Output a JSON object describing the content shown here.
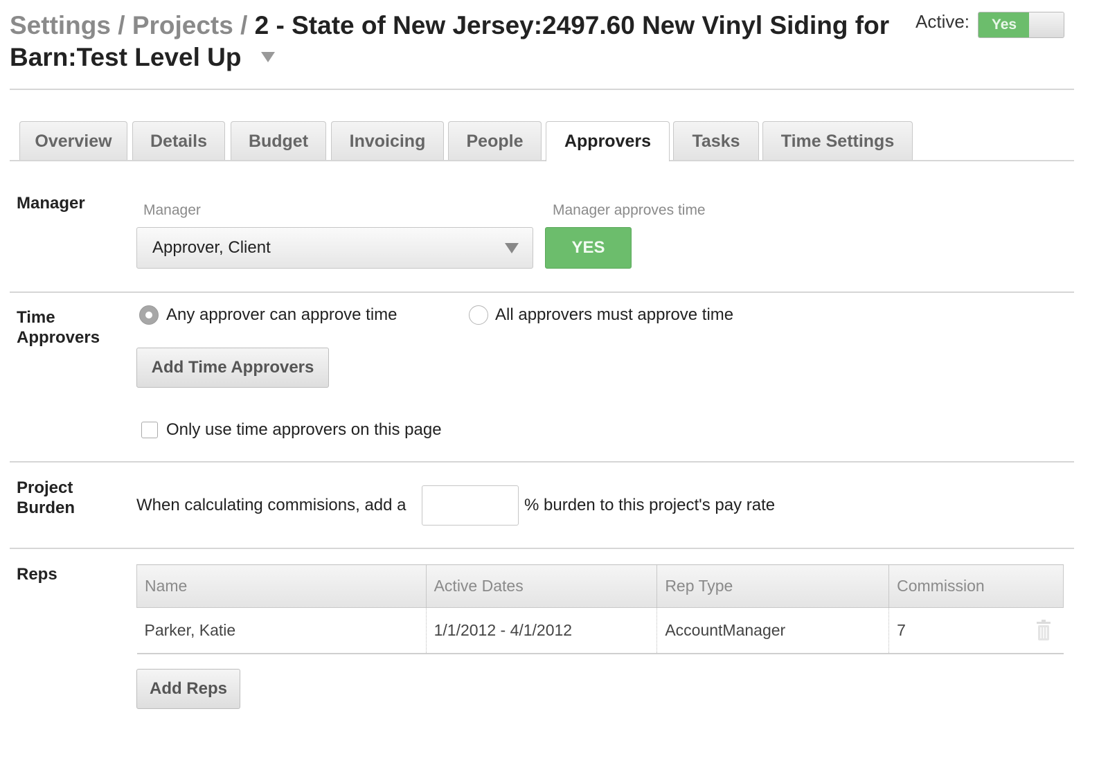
{
  "header": {
    "crumb_settings": "Settings /",
    "crumb_projects": "Projects /",
    "title": "2 - State of New Jersey:2497.60 New Vinyl Siding for Barn:Test Level Up",
    "active_label": "Active:",
    "active_value": "Yes"
  },
  "tabs": [
    {
      "label": "Overview"
    },
    {
      "label": "Details"
    },
    {
      "label": "Budget"
    },
    {
      "label": "Invoicing"
    },
    {
      "label": "People"
    },
    {
      "label": "Approvers",
      "active": true
    },
    {
      "label": "Tasks"
    },
    {
      "label": "Time Settings"
    }
  ],
  "manager": {
    "section_label": "Manager",
    "field_label": "Manager",
    "selected": "Approver, Client",
    "approves_label": "Manager approves time",
    "approves_value": "YES"
  },
  "time_approvers": {
    "section_label_1": "Time",
    "section_label_2": "Approvers",
    "option_any": "Any approver can approve time",
    "option_all": "All approvers must approve time",
    "selected_option": "any",
    "add_button": "Add Time Approvers",
    "only_use_label": "Only use time approvers on this page",
    "only_use_checked": false
  },
  "burden": {
    "section_label_1": "Project",
    "section_label_2": "Burden",
    "text_before": "When calculating commisions, add a",
    "value": "",
    "text_after": "% burden to this project's pay rate"
  },
  "reps": {
    "section_label": "Reps",
    "columns": [
      "Name",
      "Active Dates",
      "Rep Type",
      "Commission"
    ],
    "rows": [
      {
        "name": "Parker, Katie",
        "dates": "1/1/2012 - 4/1/2012",
        "type": "AccountManager",
        "commission": "7"
      }
    ],
    "add_button": "Add Reps"
  },
  "colors": {
    "accent_green": "#6cbd6c",
    "muted_text": "#8a8a8a"
  },
  "icons": {
    "title_dropdown": "caret-down-icon",
    "select_dropdown": "caret-down-icon",
    "row_delete": "trash-icon"
  }
}
